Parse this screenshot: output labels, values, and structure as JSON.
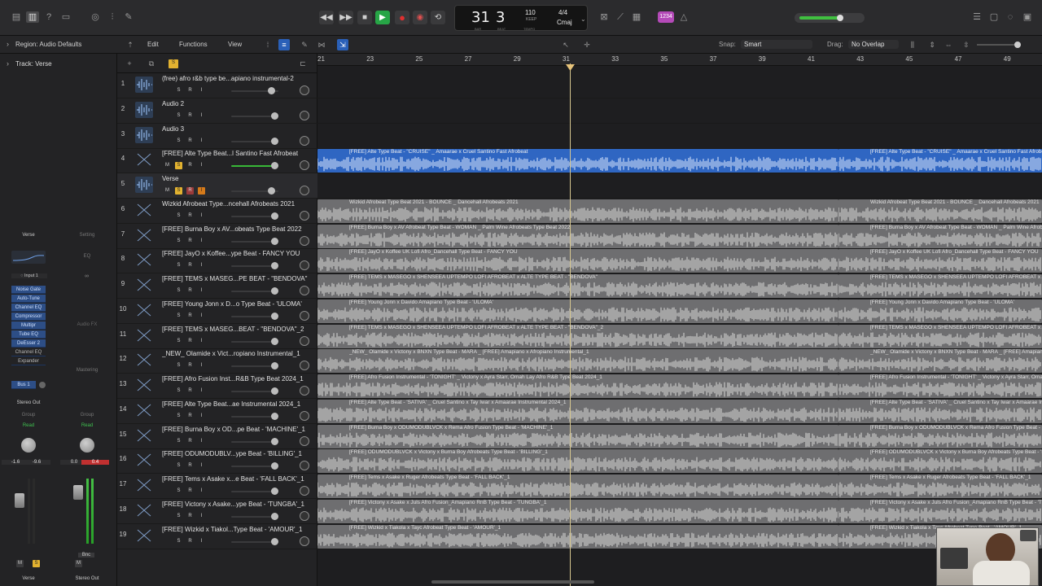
{
  "topbar": {
    "left_icons": [
      "library-icon",
      "inspector-icon",
      "quick-help-icon",
      "toolbar-icon"
    ],
    "mid_left_icons": [
      "smart-controls-icon",
      "mixer-icon",
      "editors-icon"
    ],
    "lcd": {
      "bar": "31",
      "beat": "3",
      "bar_label": "BAR",
      "beat_label": "BEAT",
      "tempo": "110",
      "tempo_mode": "KEEP",
      "tempo_label": "TEMPO",
      "signature": "4/4",
      "key": "Cmaj"
    },
    "count_in": "1234",
    "master_volume_level": 0.68
  },
  "row2": {
    "menus": [
      "Edit",
      "Functions",
      "View"
    ],
    "snap_label": "Snap:",
    "snap_value": "Smart",
    "drag_label": "Drag:",
    "drag_value": "No Overlap"
  },
  "inspector": {
    "region_row": "Region: Audio Defaults",
    "track_row": "Track: Verse",
    "strip1": {
      "setting": "Verse",
      "input": "Input 1",
      "plugins": [
        "Noise Gate",
        "Auto-Tune",
        "Channel EQ",
        "Compressor",
        "Multipr",
        "Tube EQ",
        "DeEsser 2",
        "Channel EQ",
        "Expander"
      ],
      "send": "Bus 1",
      "output": "Stereo Out",
      "group": "Group",
      "automation": "Read",
      "vol_left": "-1.6",
      "vol_right": "-9.6",
      "mute": "M",
      "solo": "S",
      "name": "Verse"
    },
    "strip2": {
      "setting": "Setting",
      "eq": "EQ",
      "audio_fx": "Audio FX",
      "mastering": "Mastering",
      "group": "Group",
      "automation": "Read",
      "vol_left": "0.0",
      "vol_right": "0.4",
      "mute": "M",
      "bounce": "Bnc",
      "name": "Stereo Out"
    }
  },
  "tracks": [
    {
      "num": "1",
      "name": "(free) afro r&b type be...apiano instrumental-2",
      "buttons": [
        "S",
        "R",
        "I"
      ],
      "fader": 0.84,
      "lane": []
    },
    {
      "num": "2",
      "name": "Audio 2",
      "buttons": [
        "S",
        "R",
        "I"
      ],
      "fader": 0.92,
      "lane": []
    },
    {
      "num": "3",
      "name": "Audio 3",
      "buttons": [
        "S",
        "R",
        "I"
      ],
      "fader": 0.92,
      "lane": []
    },
    {
      "num": "4",
      "name": "[FREE] Alte Type Beat...l Santino Fast Afrobeat",
      "buttons": [
        "M",
        "S",
        "R",
        "I"
      ],
      "solo_on": true,
      "green": true,
      "fader": 0.92,
      "selected": false,
      "lane": [
        {
          "title": "[FREE] Alte Type Beat - \"CRUISE\" _ Amaarae x Cruel Santino Fast Afrobeat",
          "blue": true
        },
        {
          "title": "[FREE] Alte Type Beat - \"CRUISE\" _ Amaarae x Cruel Santino Fast Afrobeat",
          "blue": true
        }
      ]
    },
    {
      "num": "5",
      "name": "Verse",
      "buttons": [
        "M",
        "S",
        "R",
        "I"
      ],
      "solo_on": true,
      "rec_on": true,
      "input_on": true,
      "fader": 0.84,
      "selected": true,
      "lane": []
    },
    {
      "num": "6",
      "name": "Wizkid Afrobeat Type...ncehall Afrobeats 2021",
      "buttons": [
        "S",
        "R",
        "I"
      ],
      "fader": 0.92,
      "lane": [
        {
          "title": "Wizkid Afrobeat Type Beat 2021 - BOUNCE _ Dancehall Afrobeats 2021"
        },
        {
          "title": "Wizkid Afrobeat Type Beat 2021 - BOUNCE _ Dancehall Afrobeats 2021"
        }
      ]
    },
    {
      "num": "7",
      "name": "[FREE] Burna Boy x AV...obeats Type Beat 2022",
      "buttons": [
        "S",
        "R",
        "I"
      ],
      "fader": 0.92,
      "lane": [
        {
          "title": "[FREE] Burna Boy x AV Afrobeat Type Beat - WOMAN _ Palm Wine Afrobeats Type Beat 2022"
        },
        {
          "title": "[FREE] Burna Boy x AV Afrobeat Type Beat - WOMAN _ Palm Wine Afrobeats Type Beat 2022"
        }
      ]
    },
    {
      "num": "8",
      "name": "[FREE] JayO x Koffee...ype Beat - FANCY YOU",
      "buttons": [
        "S",
        "R",
        "I"
      ],
      "fader": 0.92,
      "lane": [
        {
          "title": "[FREE] JayO x Koffee UK Lofi Afro_Dancehall Type Beat - FANCY YOU"
        },
        {
          "title": "[FREE] JayO x Koffee UK Lofi Afro_Dancehall Type Beat - FANCY YOU"
        }
      ]
    },
    {
      "num": "9",
      "name": "[FREE] TEMS x MASEG...PE BEAT - \"BENDOVA\"",
      "buttons": [
        "S",
        "R",
        "I"
      ],
      "fader": 0.92,
      "lane": [
        {
          "title": "[FREE] TEMS x MASEGO x SHENSEEA UPTEMPO LOFI AFROBEAT x ALTE TYPE BEAT - \"BENDOVA\""
        },
        {
          "title": "[FREE] TEMS x MASEGO x SHENSEEA UPTEMPO LOFI AFROBEAT x ALTE TYPE BEAT - \"BENDOVA\""
        }
      ]
    },
    {
      "num": "10",
      "name": "[FREE] Young Jonn x D...o Type Beat - 'ULOMA'",
      "buttons": [
        "S",
        "R",
        "I"
      ],
      "fader": 0.92,
      "lane": [
        {
          "title": "[FREE] Young Jonn x Davido Amapiano Type Beat - 'ULOMA'"
        },
        {
          "title": "[FREE] Young Jonn x Davido Amapiano Type Beat - 'ULOMA'"
        }
      ]
    },
    {
      "num": "11",
      "name": "[FREE] TEMS x MASEG...BEAT - \"BENDOVA\"_2",
      "buttons": [
        "S",
        "R",
        "I"
      ],
      "fader": 0.92,
      "lane": [
        {
          "title": "[FREE] TEMS x MASEGO x SHENSEEA UPTEMPO LOFI AFROBEAT x ALTE TYPE BEAT - \"BENDOVA\"_2"
        },
        {
          "title": "[FREE] TEMS x MASEGO x SHENSEEA UPTEMPO LOFI AFROBEAT x ALTE TYPE BEAT - \"BENDOVA\"_2"
        }
      ]
    },
    {
      "num": "12",
      "name": "_NEW_ Olamide x Vict...ropiano Instrumental_1",
      "buttons": [
        "S",
        "R",
        "I"
      ],
      "fader": 0.92,
      "lane": [
        {
          "title": "_NEW_ Olamide x Victony x BNXN Type Beat - MARA _ [FREE] Amapiano x Afropiano Instrumental_1"
        },
        {
          "title": "_NEW_ Olamide x Victony x BNXN Type Beat - MARA _ [FREE] Amapiano x Afropiano Instrumental_1"
        }
      ]
    },
    {
      "num": "13",
      "name": "[FREE] Afro Fusion Inst...R&B Type Beat 2024_1",
      "buttons": [
        "S",
        "R",
        "I"
      ],
      "fader": 0.92,
      "lane": [
        {
          "title": "[FREE] Afro Fusion Instrumental - 'TONIGHT' _ Victony x Ayra Starr, Omah Lay Afro R&B Type Beat 2024_1"
        },
        {
          "title": "[FREE] Afro Fusion Instrumental - 'TONIGHT' _ Victony x Ayra Starr, Omah Lay Afro R&B Type Beat 2024_1"
        }
      ]
    },
    {
      "num": "14",
      "name": "[FREE] Alte Type Beat...ae Instrumental 2024_1",
      "buttons": [
        "S",
        "R",
        "I"
      ],
      "fader": 0.92,
      "lane": [
        {
          "title": "[FREE] Alte Type Beat - 'SATIVA' _ Cruel Santino x Tay Iwar x Amaarae Instrumental 2024_1"
        },
        {
          "title": "[FREE] Alte Type Beat - 'SATIVA' _ Cruel Santino x Tay Iwar x Amaarae Instrumental 2024_1"
        }
      ]
    },
    {
      "num": "15",
      "name": "[FREE] Burna Boy x OD...pe Beat - 'MACHINE'_1",
      "buttons": [
        "S",
        "R",
        "I"
      ],
      "fader": 0.92,
      "lane": [
        {
          "title": "[FREE] Burna Boy x ODUMODUBLVCK x Rema Afro Fusion Type Beat - 'MACHINE'_1"
        },
        {
          "title": "[FREE] Burna Boy x ODUMODUBLVCK x Rema Afro Fusion Type Beat - 'MACHINE'_1"
        }
      ]
    },
    {
      "num": "16",
      "name": "[FREE] ODUMODUBLV...ype Beat - 'BILLING'_1",
      "buttons": [
        "S",
        "R",
        "I"
      ],
      "fader": 0.92,
      "lane": [
        {
          "title": "[FREE] ODUMODUBLVCK x Victony x Burna Boy Afrobeats Type Beat - 'BILLING'_1"
        },
        {
          "title": "[FREE] ODUMODUBLVCK x Victony x Burna Boy Afrobeats Type Beat - 'BILLING'_1"
        }
      ]
    },
    {
      "num": "17",
      "name": "[FREE] Tems x Asake x...e Beat - 'FALL BACK'_1",
      "buttons": [
        "S",
        "R",
        "I"
      ],
      "fader": 0.92,
      "lane": [
        {
          "title": "[FREE] Tems x Asake x Ruger Afrobeats Type Beat - 'FALL BACK'_1"
        },
        {
          "title": "[FREE] Tems x Asake x Ruger Afrobeats Type Beat - 'FALL BACK'_1"
        }
      ]
    },
    {
      "num": "18",
      "name": "[FREE] Victony x Asake...ype Beat - 'TUNGBA'_1",
      "buttons": [
        "S",
        "R",
        "I"
      ],
      "fader": 0.92,
      "lane": [
        {
          "title": "[FREE] Victony x Asake x Juls Afro Fusion_Amapiano RnB Type Beat - 'TUNGBA'_1"
        },
        {
          "title": "[FREE] Victony x Asake x Juls Afro Fusion_Amapiano RnB Type Beat - 'TUNGBA'_1"
        }
      ]
    },
    {
      "num": "19",
      "name": "[FREE] Wizkid x Tiakol...Type Beat - 'AMOUR'_1",
      "buttons": [
        "S",
        "R",
        "I"
      ],
      "fader": 0.92,
      "lane": [
        {
          "title": "[FREE] Wizkid x Tiakola x Tayc Afrobeat Type Beat - 'AMOUR'_1"
        },
        {
          "title": "[FREE] Wizkid x Tiakola x Tayc Afrobeat Type Beat - 'AMOUR'_1"
        }
      ]
    }
  ],
  "ruler": {
    "bars": [
      "21",
      "23",
      "25",
      "27",
      "29",
      "31",
      "33",
      "35",
      "37",
      "39",
      "41",
      "43",
      "45",
      "47",
      "49"
    ]
  },
  "colors": {
    "accent_blue": "#2f66c2",
    "play_green": "#27a546",
    "solo_yellow": "#e2b230",
    "record_red": "#e03030",
    "count_in_purple": "#b44ab8",
    "playhead": "#d8c890"
  }
}
